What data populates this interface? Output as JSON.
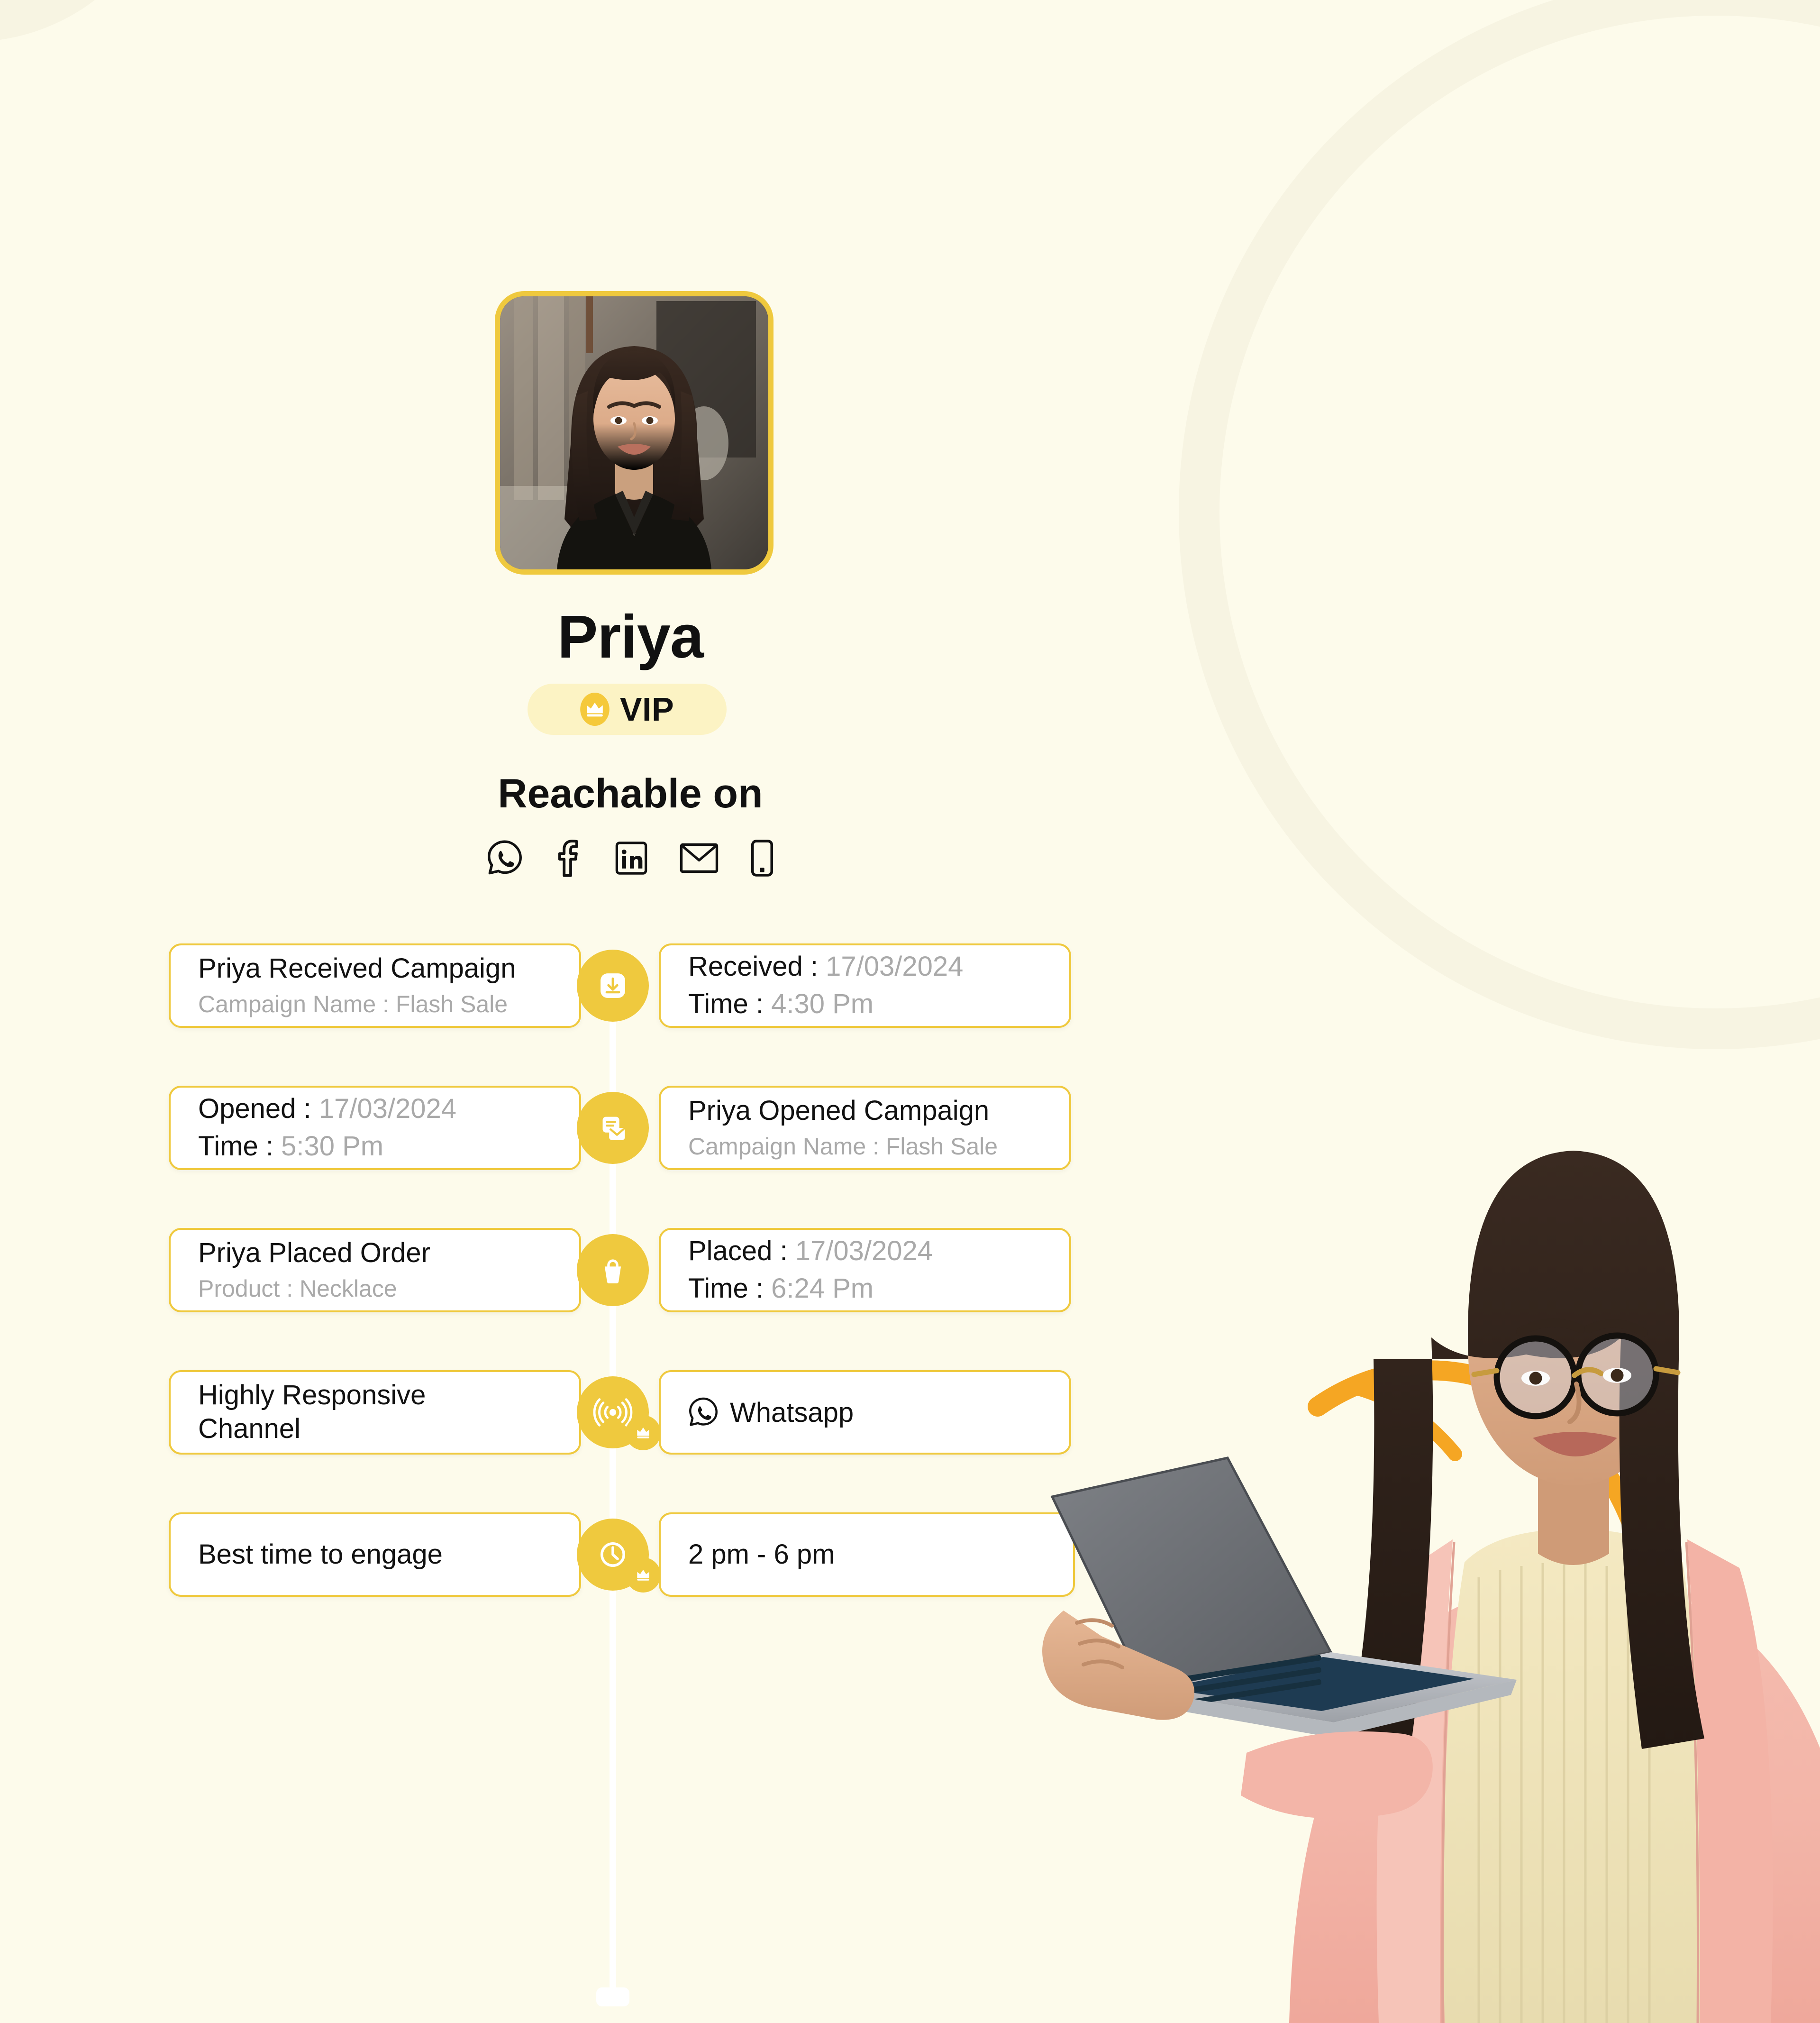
{
  "theme": {
    "background": "#FDFBEB",
    "accent_yellow": "#EFC93E",
    "accent_orange": "#F5A623",
    "card_background": "#FFFFFF",
    "muted_text": "#A9A9A9",
    "primary_text": "#111111",
    "vip_pill_background": "#FCF3C4"
  },
  "profile": {
    "avatar_name": "priya-avatar",
    "name": "Priya",
    "badge": {
      "icon": "crown-icon",
      "label": "VIP"
    }
  },
  "reachable": {
    "heading": "Reachable on",
    "channels": [
      {
        "icon": "whatsapp-icon",
        "label": "Whatsapp"
      },
      {
        "icon": "facebook-icon",
        "label": "Facebook"
      },
      {
        "icon": "linkedin-icon",
        "label": "LinkedIn"
      },
      {
        "icon": "email-icon",
        "label": "Email"
      },
      {
        "icon": "mobile-icon",
        "label": "Mobile"
      }
    ]
  },
  "timeline": [
    {
      "node_icon": "inbox-download-icon",
      "badge_icon": null,
      "left": {
        "title": "Priya Received Campaign",
        "subtitle": "Campaign Name : Flash Sale"
      },
      "right": {
        "line1_key": "Received :",
        "line1_value": "17/03/2024",
        "line2_key": "Time :",
        "line2_value": "4:30 Pm"
      }
    },
    {
      "node_icon": "opened-mail-icon",
      "badge_icon": null,
      "left": {
        "line1_key": "Opened :",
        "line1_value": "17/03/2024",
        "line2_key": "Time :",
        "line2_value": "5:30 Pm"
      },
      "right": {
        "title": "Priya Opened Campaign",
        "subtitle": "Campaign Name : Flash Sale"
      }
    },
    {
      "node_icon": "shopping-bag-icon",
      "badge_icon": null,
      "left": {
        "title": "Priya Placed Order",
        "subtitle": "Product : Necklace"
      },
      "right": {
        "line1_key": "Placed :",
        "line1_value": "17/03/2024",
        "line2_key": "Time :",
        "line2_value": "6:24 Pm"
      }
    },
    {
      "node_icon": "broadcast-signal-icon",
      "badge_icon": "crown-icon",
      "left": {
        "title": "Highly Responsive Channel"
      },
      "right": {
        "icon": "whatsapp-icon",
        "title": "Whatsapp"
      }
    },
    {
      "node_icon": "clock-icon",
      "badge_icon": "crown-icon",
      "left": {
        "title": "Best time to engage"
      },
      "right": {
        "title": "2 pm - 6 pm"
      }
    }
  ]
}
